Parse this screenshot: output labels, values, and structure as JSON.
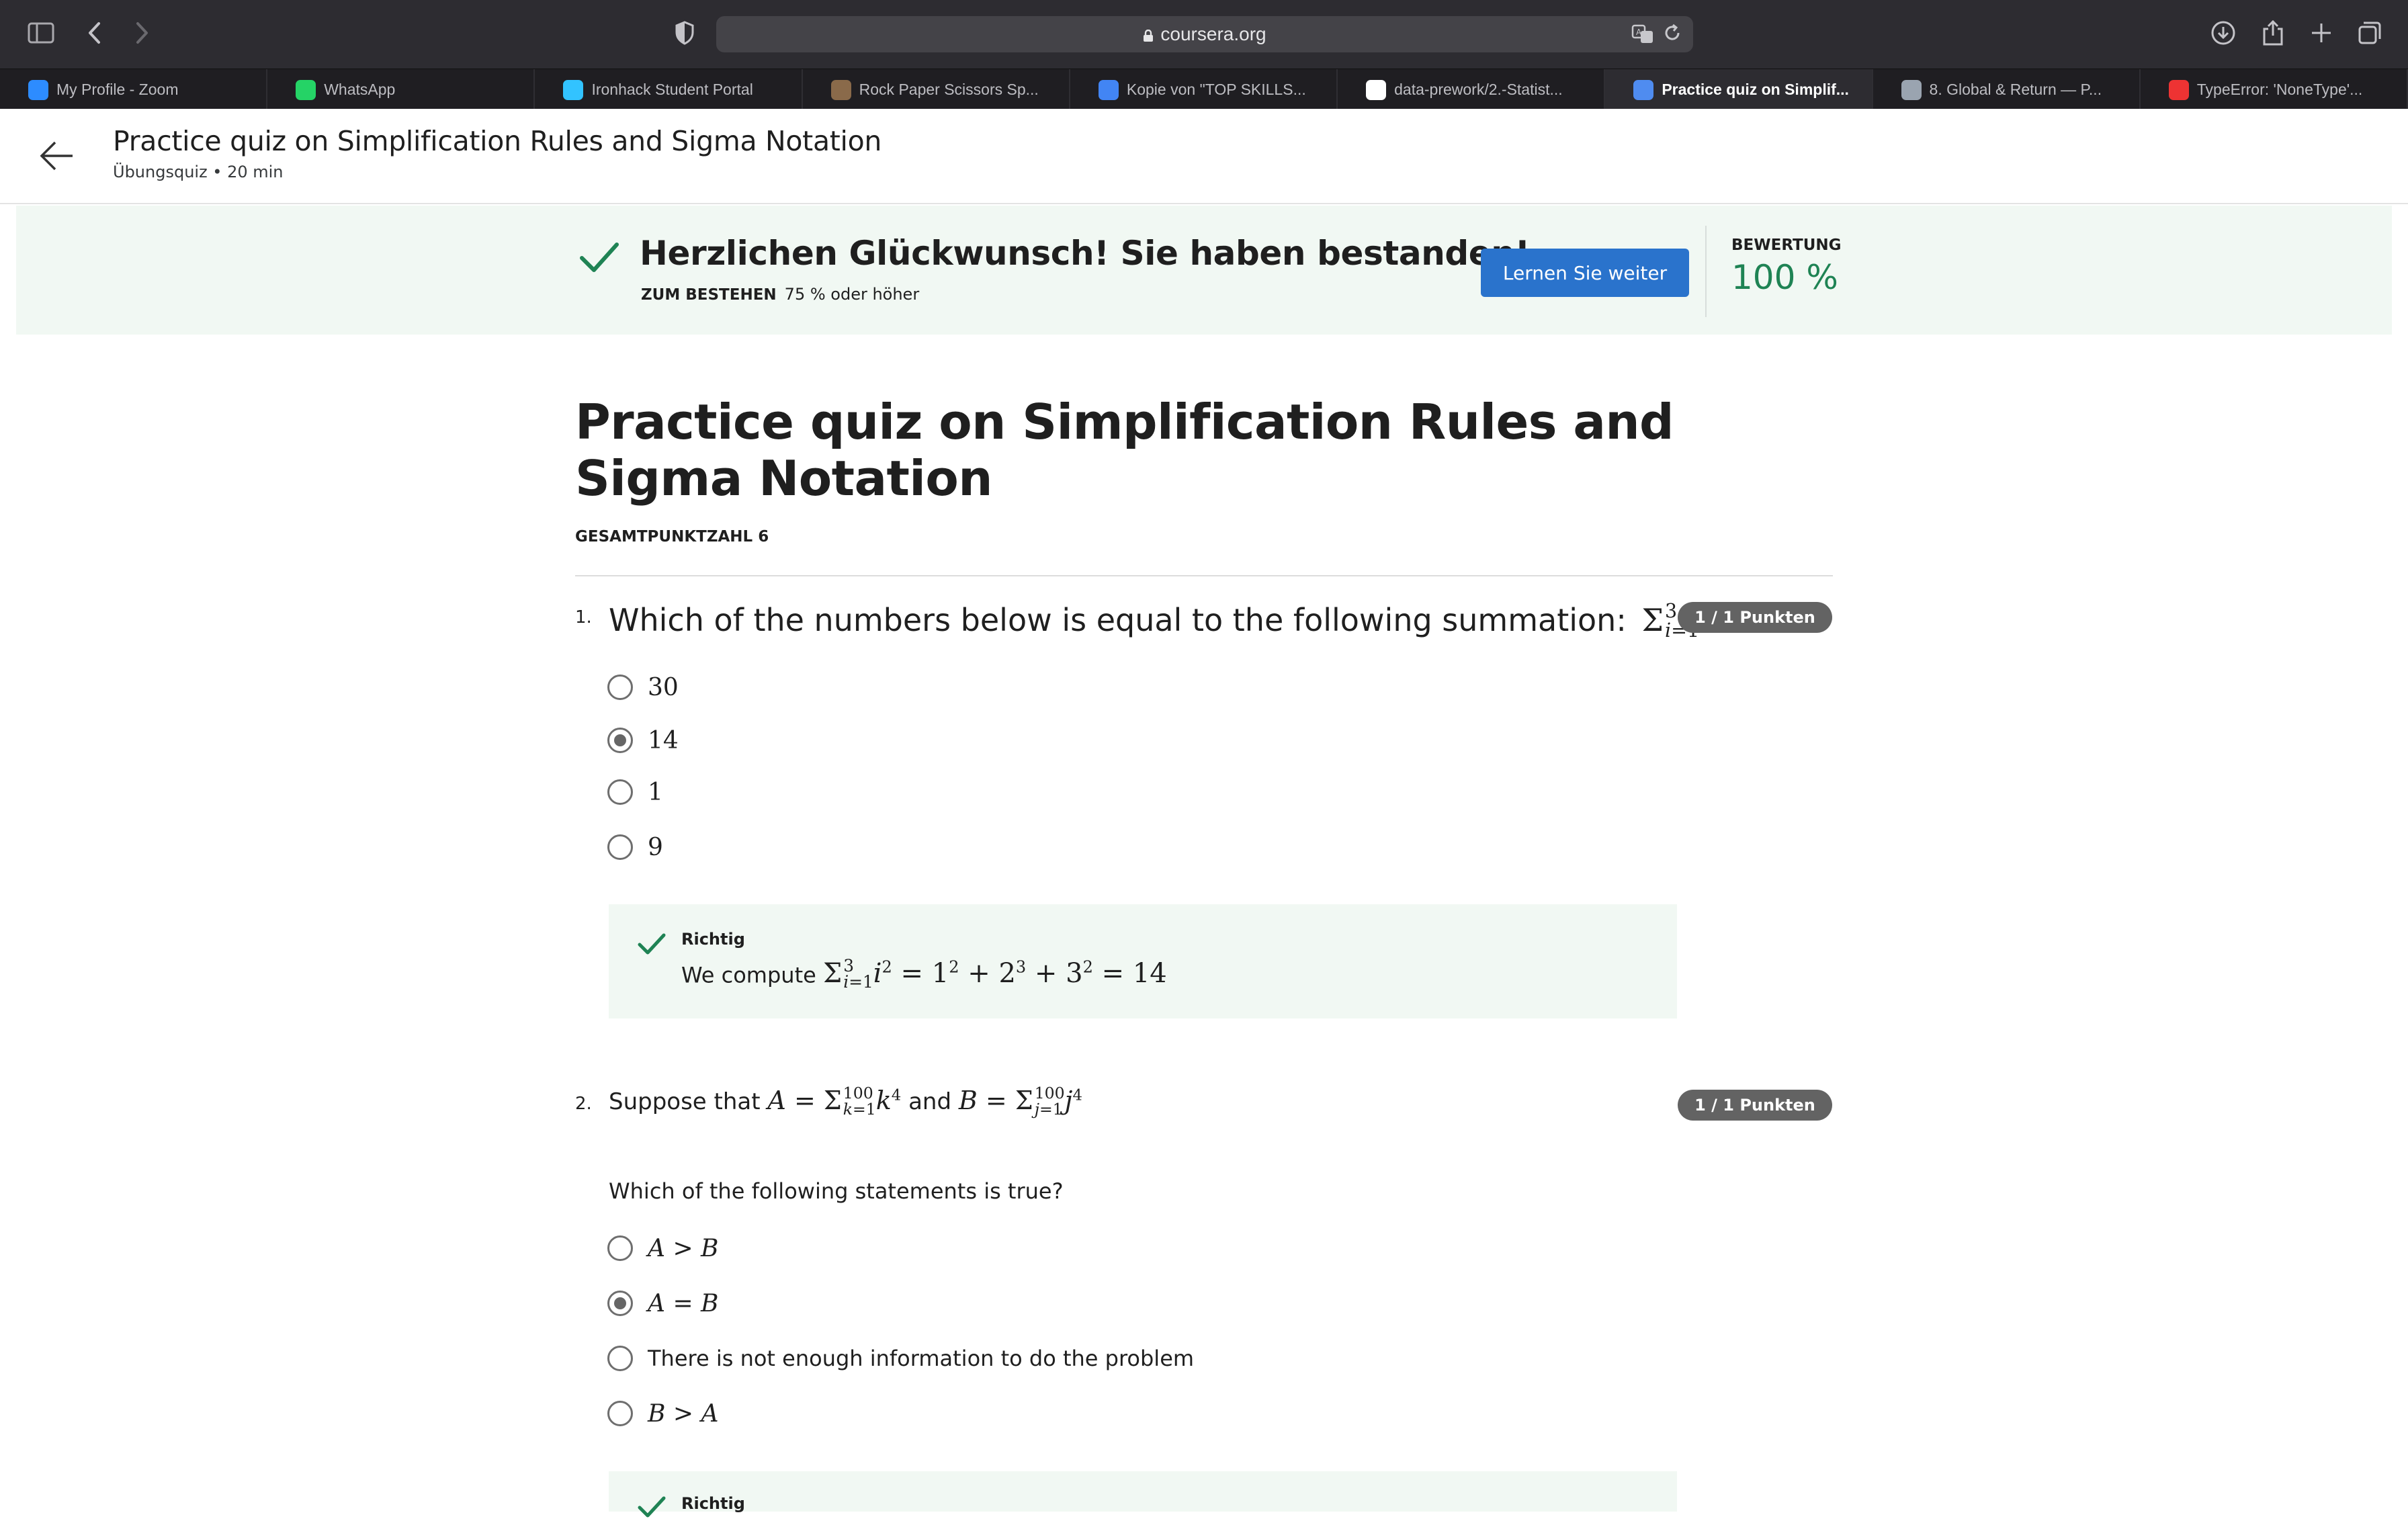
{
  "browser": {
    "url": "coursera.org",
    "tabs": [
      {
        "label": "My Profile - Zoom",
        "icon": "zoom-icon",
        "color": "#2d8cff"
      },
      {
        "label": "WhatsApp",
        "icon": "whatsapp-icon",
        "color": "#25d366"
      },
      {
        "label": "Ironhack Student Portal",
        "icon": "ironhack-icon",
        "color": "#32c3ff"
      },
      {
        "label": "Rock Paper Scissors Sp...",
        "icon": "rps-icon",
        "color": "#8a6a4a"
      },
      {
        "label": "Kopie von \"TOP SKILLS...",
        "icon": "google-docs-icon",
        "color": "#4285f4"
      },
      {
        "label": "data-prework/2.-Statist...",
        "icon": "github-icon",
        "color": "#ffffff"
      },
      {
        "label": "Practice quiz on Simplif...",
        "icon": "coursera-icon",
        "color": "#4f8cf0"
      },
      {
        "label": "8. Global & Return — P...",
        "icon": "book-icon",
        "color": "#9aa4b0"
      },
      {
        "label": "TypeError: 'NoneType'...",
        "icon": "stack-icon",
        "color": "#e33"
      }
    ],
    "active_tab": 6
  },
  "header": {
    "title": "Practice quiz on Simplification Rules and Sigma Notation",
    "subtitle": "Übungsquiz • 20 min"
  },
  "banner": {
    "message": "Herzlichen Glückwunsch! Sie haben bestanden!",
    "pass_label": "ZUM BESTEHEN",
    "pass_value": "75 % oder höher",
    "continue_label": "Lernen Sie weiter",
    "grade_label": "BEWERTUNG",
    "grade_value": "100 %"
  },
  "quiz": {
    "title": "Practice quiz on Simplification Rules and Sigma Notation",
    "total_points_label": "GESAMTPUNKTZAHL 6",
    "questions": [
      {
        "number": "1.",
        "text": "Which of the numbers below is equal to the following summation:",
        "points": "1 / 1 Punkten",
        "options": [
          "30",
          "14",
          "1",
          "9"
        ],
        "selected": 1,
        "feedback_title": "Richtig",
        "feedback_text": "We compute"
      },
      {
        "number": "2.",
        "text_a": "Suppose that",
        "text_and": "and",
        "text2": "Which of the following statements is true?",
        "points": "1 / 1 Punkten",
        "options": [
          "A > B",
          "A = B",
          "There is not enough information to do the problem",
          "B > A"
        ],
        "selected": 1,
        "feedback_title": "Richtig"
      }
    ]
  },
  "colors": {
    "accent": "#2a73cc",
    "success": "#1f8354",
    "banner_bg": "#f1f8f3",
    "badge": "#636363"
  }
}
